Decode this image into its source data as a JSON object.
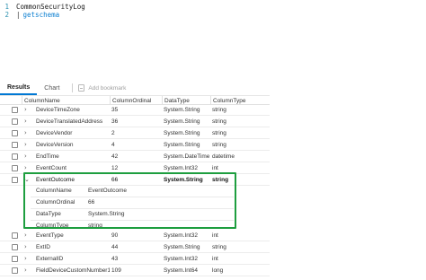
{
  "editor": {
    "lines": [
      {
        "number": "1",
        "text": "CommonSecurityLog"
      },
      {
        "number": "2",
        "pipe": "|",
        "keyword": "getschema"
      }
    ]
  },
  "tabs": {
    "results": "Results",
    "chart": "Chart",
    "add_bookmark": "Add bookmark"
  },
  "grid": {
    "headers": [
      "ColumnName",
      "ColumnOrdinal",
      "DataType",
      "ColumnType"
    ],
    "rows_before": [
      {
        "name": "DeviceTimeZone",
        "ordinal": "35",
        "datatype": "System.String",
        "type": "string"
      },
      {
        "name": "DeviceTranslatedAddress",
        "ordinal": "36",
        "datatype": "System.String",
        "type": "string"
      },
      {
        "name": "DeviceVendor",
        "ordinal": "2",
        "datatype": "System.String",
        "type": "string"
      },
      {
        "name": "DeviceVersion",
        "ordinal": "4",
        "datatype": "System.String",
        "type": "string"
      },
      {
        "name": "EndTime",
        "ordinal": "42",
        "datatype": "System.DateTime",
        "type": "datetime"
      },
      {
        "name": "EventCount",
        "ordinal": "12",
        "datatype": "System.Int32",
        "type": "int"
      }
    ],
    "expanded_row": {
      "name": "EventOutcome",
      "ordinal": "66",
      "datatype": "System.String",
      "type": "string"
    },
    "details": [
      {
        "label": "ColumnName",
        "value": "EventOutcome"
      },
      {
        "label": "ColumnOrdinal",
        "value": "66"
      },
      {
        "label": "DataType",
        "value": "System.String"
      },
      {
        "label": "ColumnType",
        "value": "string"
      }
    ],
    "rows_after": [
      {
        "name": "EventType",
        "ordinal": "90",
        "datatype": "System.Int32",
        "type": "int"
      },
      {
        "name": "ExtID",
        "ordinal": "44",
        "datatype": "System.String",
        "type": "string"
      },
      {
        "name": "ExternalID",
        "ordinal": "43",
        "datatype": "System.Int32",
        "type": "int"
      },
      {
        "name": "FieldDeviceCustomNumber1",
        "ordinal": "109",
        "datatype": "System.Int64",
        "type": "long"
      }
    ]
  },
  "colors": {
    "accent": "#0078d4",
    "highlight": "#1e9e3f",
    "keyword": "#0b7fd1",
    "line_number": "#2b91af"
  }
}
